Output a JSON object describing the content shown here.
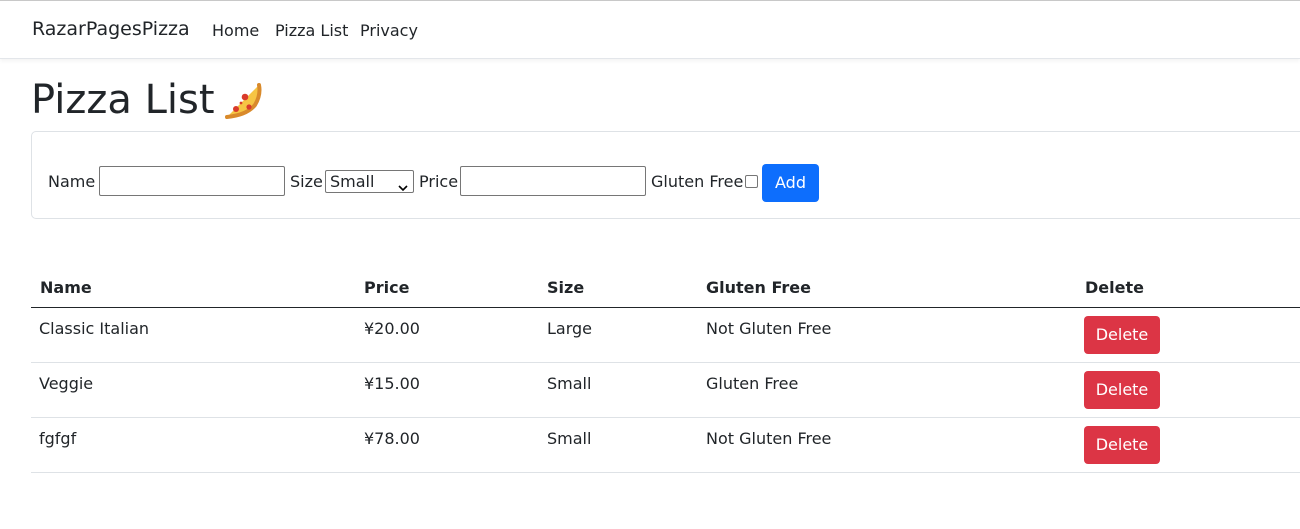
{
  "navbar": {
    "brand": "RazarPagesPizza",
    "links": [
      {
        "label": "Home"
      },
      {
        "label": "Pizza List"
      },
      {
        "label": "Privacy"
      }
    ]
  },
  "page": {
    "title": "Pizza List",
    "title_icon": "pizza-slice-icon"
  },
  "form": {
    "name_label": "Name",
    "name_value": "",
    "size_label": "Size",
    "size_selected": "Small",
    "price_label": "Price",
    "price_value": "",
    "gluten_free_label": "Gluten Free",
    "gluten_free_checked": false,
    "add_button": "Add"
  },
  "table": {
    "columns": [
      "Name",
      "Price",
      "Size",
      "Gluten Free",
      "Delete"
    ],
    "rows": [
      {
        "name": "Classic Italian",
        "price": "¥20.00",
        "size": "Large",
        "gluten_free": "Not Gluten Free",
        "action": "Delete"
      },
      {
        "name": "Veggie",
        "price": "¥15.00",
        "size": "Small",
        "gluten_free": "Gluten Free",
        "action": "Delete"
      },
      {
        "name": "fgfgf",
        "price": "¥78.00",
        "size": "Small",
        "gluten_free": "Not Gluten Free",
        "action": "Delete"
      }
    ]
  },
  "colors": {
    "primary": "#0d6efd",
    "danger": "#dc3545",
    "text": "#212529",
    "border": "#dee2e6"
  }
}
